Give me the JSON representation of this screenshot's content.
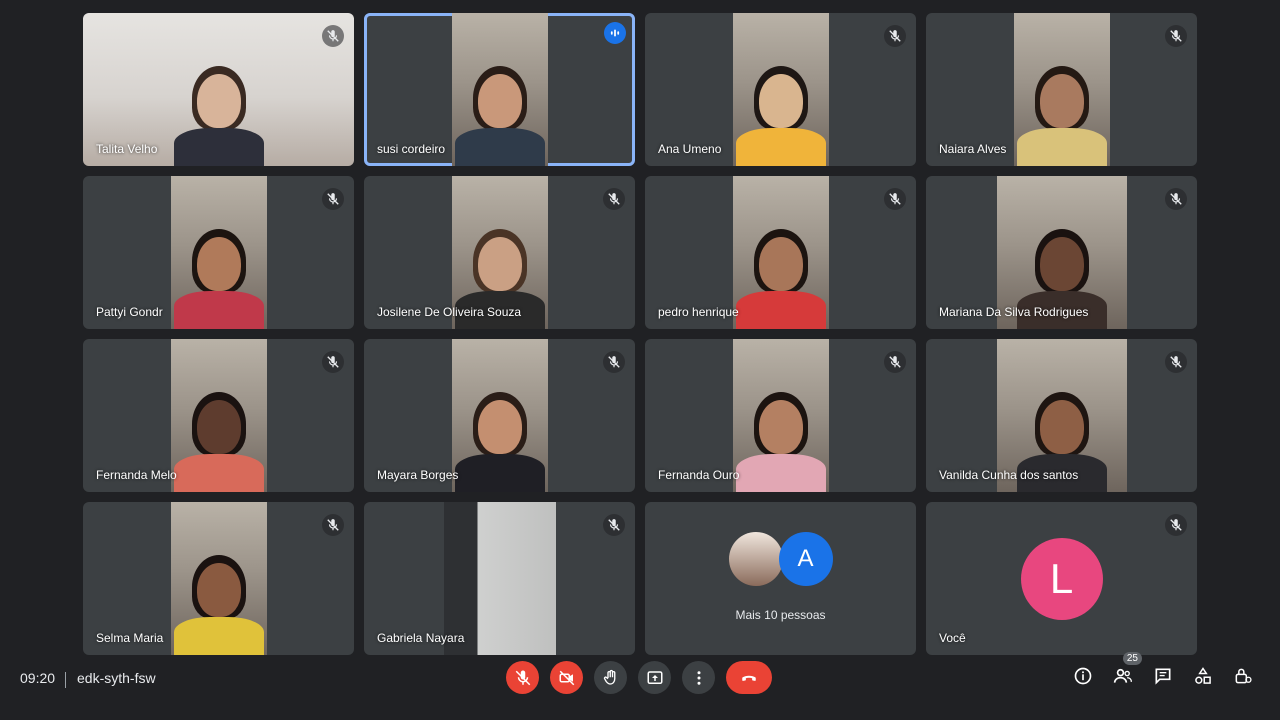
{
  "meeting": {
    "time": "09:20",
    "code": "edk-syth-fsw",
    "participant_count": "25"
  },
  "tiles": [
    {
      "name": "Talita Velho",
      "muted": true,
      "layout": "full",
      "skin": "#d8b49a",
      "hair": "#3a2a22",
      "shirt": "#2d2f3a"
    },
    {
      "name": "susi cordeiro",
      "speaking": true,
      "layout": "narrow",
      "skin": "#c9987a",
      "hair": "#2a1d17",
      "shirt": "#2f3b4a"
    },
    {
      "name": "Ana Umeno",
      "muted": true,
      "layout": "narrow",
      "skin": "#d9b58f",
      "hair": "#1e1714",
      "shirt": "#f0b43a"
    },
    {
      "name": "Naiara Alves",
      "muted": true,
      "layout": "narrow",
      "skin": "#a97a5f",
      "hair": "#241913",
      "shirt": "#d9c27a"
    },
    {
      "name": "Pattyi Gondr",
      "muted": true,
      "layout": "narrow",
      "skin": "#b07a5a",
      "hair": "#1c1410",
      "shirt": "#c0394a"
    },
    {
      "name": "Josilene De Oliveira Souza",
      "muted": true,
      "layout": "narrow",
      "skin": "#caa084",
      "hair": "#4a3426",
      "shirt": "#2a2a2a"
    },
    {
      "name": "pedro henrique",
      "muted": true,
      "layout": "narrow",
      "skin": "#a87659",
      "hair": "#1c1410",
      "shirt": "#d63a3a"
    },
    {
      "name": "Mariana Da Silva Rodrigues",
      "muted": true,
      "layout": "narrow",
      "skin": "#6b4634",
      "hair": "#1a1210",
      "shirt": "#3a2e2a"
    },
    {
      "name": "Fernanda Melo",
      "muted": true,
      "layout": "narrow",
      "skin": "#5e3c2e",
      "hair": "#1a1210",
      "shirt": "#d86a5a"
    },
    {
      "name": "Mayara Borges",
      "muted": true,
      "layout": "narrow",
      "skin": "#c48f70",
      "hair": "#2a1d17",
      "shirt": "#1f1f25"
    },
    {
      "name": "Fernanda Ouro",
      "muted": true,
      "layout": "narrow",
      "skin": "#b48062",
      "hair": "#1c1410",
      "shirt": "#e2a7b4"
    },
    {
      "name": "Vanilda Cunha dos santos",
      "muted": true,
      "layout": "narrow",
      "skin": "#8e5f45",
      "hair": "#1e1511",
      "shirt": "#2a2a2e"
    },
    {
      "name": "Selma Maria",
      "muted": true,
      "layout": "narrow",
      "skin": "#8a5a40",
      "hair": "#1a1210",
      "shirt": "#e0c23a"
    },
    {
      "name": "Gabriela Nayara",
      "muted": true,
      "layout": "room",
      "skin": "#a0a0a0",
      "hair": "#2a2a2a",
      "shirt": "#555555"
    }
  ],
  "more": {
    "label": "Mais 10 pessoas",
    "letter": "A",
    "letter_color": "#1a73e8"
  },
  "self": {
    "name": "Você",
    "letter": "L",
    "avatar_color": "#e8477f",
    "muted": true
  },
  "controls": {
    "accent_red": "#ea4335",
    "speaking_blue": "#8ab4f8"
  }
}
